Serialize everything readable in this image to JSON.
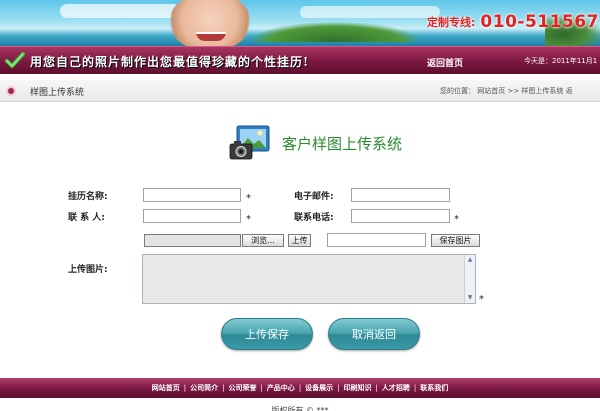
{
  "banner": {
    "hotline_label": "定制专线:",
    "hotline_number": "010-511567"
  },
  "topband": {
    "slogan": "用您自己的照片制作出您最值得珍藏的个性挂历!",
    "home_link": "返回首页",
    "today": "今天是：2011年11月1"
  },
  "breadcrumb": {
    "title": "样图上传系统",
    "location": "您的位置：  网站首页  >>  样图上传系统    返"
  },
  "system": {
    "title": "客户样图上传系统"
  },
  "form": {
    "calendar_name_label": "挂历名称:",
    "email_label": "电子邮件:",
    "contact_label": "联  系  人:",
    "phone_label": "联系电话:",
    "upload_label": "上传图片:",
    "required_mark": "*",
    "browse_button": "浏览...",
    "upload_button": "上传",
    "save_image_button": "保存图片",
    "submit_button": "上传保存",
    "cancel_button": "取消返回"
  },
  "footer": {
    "links": [
      "网站首页",
      "公司简介",
      "公司荣誉",
      "产品中心",
      "设备展示",
      "印刷知识",
      "人才招聘",
      "联系我们"
    ],
    "separator": "|",
    "cut_text": "版权所有 ©              ***           "
  },
  "colors": {
    "band": "#7a1840",
    "button": "#3a9aa6",
    "title_green": "#2a8a30",
    "hotline_red": "#e52222"
  }
}
